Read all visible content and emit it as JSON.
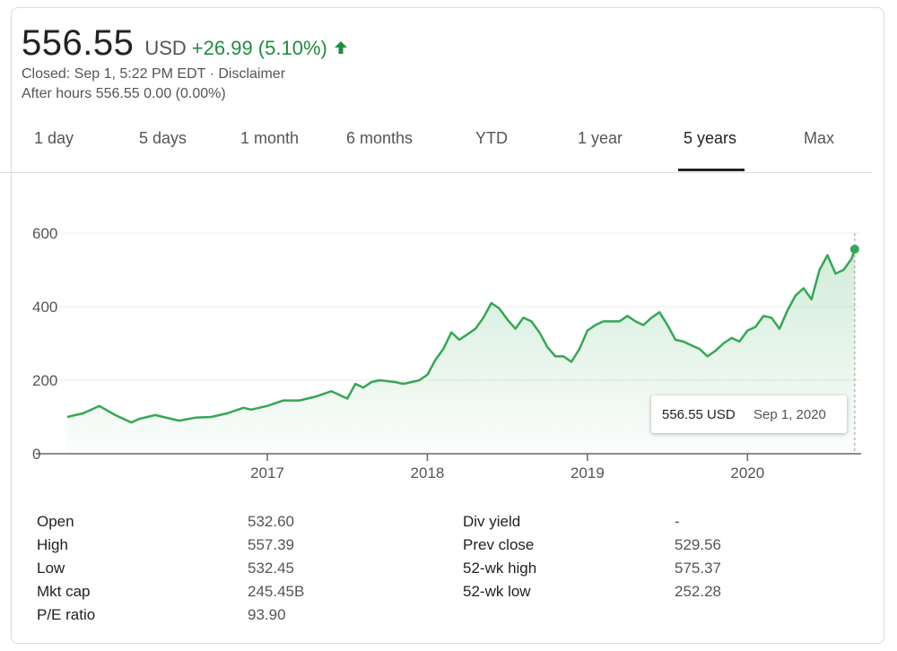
{
  "quote": {
    "price": "556.55",
    "currency": "USD",
    "change": "+26.99 (5.10%)",
    "closed_text": "Closed: Sep 1, 5:22 PM EDT · Disclaimer",
    "after_hours_text": "After hours 556.55 0.00 (0.00%)"
  },
  "tabs": [
    {
      "label": "1 day"
    },
    {
      "label": "5 days"
    },
    {
      "label": "1 month"
    },
    {
      "label": "6 months"
    },
    {
      "label": "YTD"
    },
    {
      "label": "1 year"
    },
    {
      "label": "5 years",
      "active": true
    },
    {
      "label": "Max"
    }
  ],
  "tooltip": {
    "value": "556.55 USD",
    "date": "Sep 1, 2020"
  },
  "stats": {
    "left": [
      {
        "label": "Open",
        "value": "532.60"
      },
      {
        "label": "High",
        "value": "557.39"
      },
      {
        "label": "Low",
        "value": "532.45"
      },
      {
        "label": "Mkt cap",
        "value": "245.45B"
      },
      {
        "label": "P/E ratio",
        "value": "93.90"
      }
    ],
    "right": [
      {
        "label": "Div yield",
        "value": "-"
      },
      {
        "label": "Prev close",
        "value": "529.56"
      },
      {
        "label": "52-wk high",
        "value": "575.37"
      },
      {
        "label": "52-wk low",
        "value": "252.28"
      }
    ]
  },
  "colors": {
    "up": "#1e8e3e",
    "line": "#34a853"
  },
  "chart_data": {
    "type": "area",
    "xlabel": "",
    "ylabel": "",
    "ylim": [
      0,
      600
    ],
    "yticks": [
      "0",
      "200",
      "400",
      "600"
    ],
    "xticks": [
      "2017",
      "2018",
      "2019",
      "2020"
    ],
    "x_tick_values": [
      2017.0,
      2018.0,
      2019.0,
      2020.0
    ],
    "xlim": [
      2015.61,
      2020.71
    ],
    "grid": true,
    "series": [
      {
        "x": [
          2015.75,
          2015.85,
          2015.95,
          2016.05,
          2016.15,
          2016.2,
          2016.3,
          2016.4,
          2016.45,
          2016.55,
          2016.65,
          2016.75,
          2016.85,
          2016.9,
          2017.0,
          2017.1,
          2017.2,
          2017.3,
          2017.4,
          2017.45,
          2017.5,
          2017.55,
          2017.6,
          2017.65,
          2017.7,
          2017.8,
          2017.85,
          2017.9,
          2017.95,
          2018.0,
          2018.05,
          2018.1,
          2018.15,
          2018.2,
          2018.25,
          2018.3,
          2018.35,
          2018.4,
          2018.45,
          2018.5,
          2018.55,
          2018.6,
          2018.65,
          2018.7,
          2018.75,
          2018.8,
          2018.85,
          2018.9,
          2018.95,
          2019.0,
          2019.05,
          2019.1,
          2019.15,
          2019.2,
          2019.25,
          2019.3,
          2019.35,
          2019.4,
          2019.45,
          2019.5,
          2019.55,
          2019.6,
          2019.65,
          2019.7,
          2019.75,
          2019.8,
          2019.85,
          2019.9,
          2019.95,
          2020.0,
          2020.05,
          2020.1,
          2020.15,
          2020.2,
          2020.25,
          2020.3,
          2020.35,
          2020.4,
          2020.45,
          2020.5,
          2020.55,
          2020.6,
          2020.65,
          2020.67
        ],
        "y": [
          100,
          110,
          130,
          105,
          85,
          95,
          105,
          95,
          90,
          98,
          100,
          110,
          125,
          120,
          130,
          145,
          145,
          155,
          170,
          160,
          150,
          190,
          180,
          195,
          200,
          195,
          190,
          195,
          200,
          215,
          255,
          285,
          330,
          310,
          325,
          340,
          370,
          410,
          395,
          365,
          340,
          370,
          360,
          330,
          290,
          265,
          265,
          250,
          285,
          335,
          350,
          360,
          360,
          360,
          375,
          360,
          350,
          370,
          385,
          350,
          310,
          305,
          295,
          285,
          265,
          280,
          300,
          315,
          305,
          335,
          345,
          375,
          370,
          340,
          390,
          430,
          450,
          420,
          500,
          540,
          490,
          500,
          530,
          556.55
        ]
      }
    ]
  }
}
